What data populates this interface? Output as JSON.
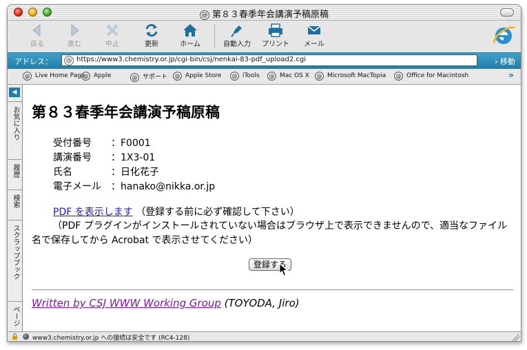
{
  "window": {
    "title": "第８３春季年会講演予稿原稿",
    "title_icon": "at-sign-icon"
  },
  "toolbar": {
    "back_label": "戻る",
    "forward_label": "進む",
    "stop_label": "中止",
    "refresh_label": "更新",
    "home_label": "ホーム",
    "autofill_label": "自動入力",
    "print_label": "プリント",
    "mail_label": "メール"
  },
  "address": {
    "label": "アドレス：",
    "url": "https://www3.chemistry.or.jp/cgi-bin/csj/nenkai-83-pdf_upload2.cgi",
    "go_label": "› 移動"
  },
  "favorites": [
    {
      "label": "Live Home Page"
    },
    {
      "label": "Apple"
    },
    {
      "label": "サポート"
    },
    {
      "label": "Apple Store"
    },
    {
      "label": "iTools"
    },
    {
      "label": "Mac OS X"
    },
    {
      "label": "Microsoft MacTopia"
    },
    {
      "label": "Office for Macintosh"
    }
  ],
  "favorites_more": "»",
  "sidebar": {
    "tabs": [
      "お気に入り",
      "履歴",
      "検索",
      "スクラップブック",
      "ページ"
    ]
  },
  "page": {
    "heading": "第８３春季年会講演予稿原稿",
    "info": [
      {
        "key": "受付番号",
        "value": "：F0001"
      },
      {
        "key": "講演番号",
        "value": "：1X3-01"
      },
      {
        "key": "氏名",
        "value": "：日化花子"
      },
      {
        "key": "電子メール",
        "value": "：hanako@nikka.or.jp"
      }
    ],
    "pdf_link": "PDF を表示します",
    "pdf_note": "（登録する前に必ず確認して下さい）",
    "plugin_note": "（PDF プラグインがインストールされていない場合はブラウザ上で表示できませんので、適当なファイル名で保存してから Acrobat で表示させてください）",
    "register_button": "登録する",
    "footer_link": "Written by CSJ WWW Working Group",
    "footer_author": "(TOYODA, Jiro)"
  },
  "status": {
    "text": "www3.chemistry.or.jp への接続は安全です (RC4-128)"
  },
  "colors": {
    "address_bar": "#1f7eaa",
    "link": "#1a1acc",
    "visited_link": "#7a1a9a"
  }
}
